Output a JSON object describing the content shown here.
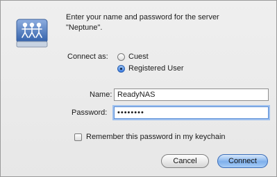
{
  "dialog": {
    "prompt_line1": "Enter your name and password for the server",
    "prompt_line2": "\"Neptune\".",
    "connect_as_label": "Connect as:",
    "guest_label": "Cuest",
    "registered_label": "Registered User",
    "selected_option": "Registered User",
    "name_label": "Name:",
    "name_value": "ReadyNAS",
    "password_label": "Password:",
    "password_value": "••••••••",
    "remember_label": "Remember this password in my keychain",
    "remember_checked": false,
    "cancel_label": "Cancel",
    "connect_label": "Connect"
  },
  "icons": {
    "server": "shared-server-icon"
  },
  "colors": {
    "accent": "#3a7be0",
    "focus_ring": "#9fc1ef"
  }
}
